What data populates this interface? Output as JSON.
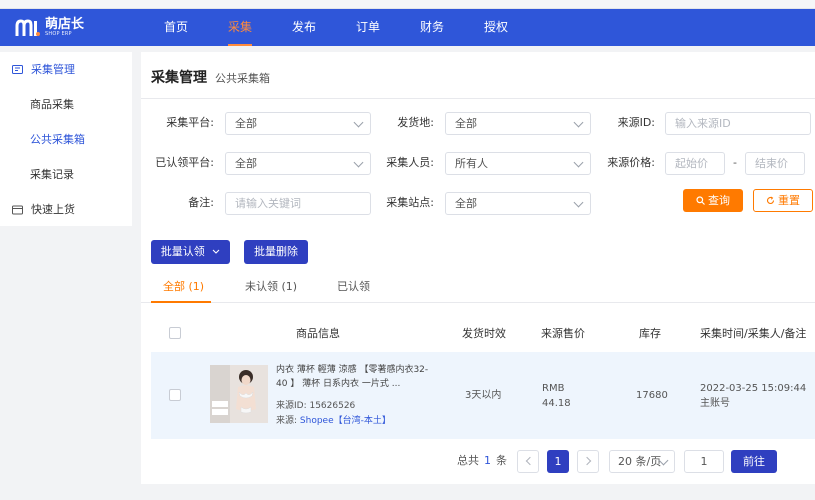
{
  "app": {
    "logo_text": "萌店长",
    "logo_sub": "SHOP ERP"
  },
  "nav": {
    "items": [
      {
        "label": "首页"
      },
      {
        "label": "采集"
      },
      {
        "label": "发布"
      },
      {
        "label": "订单"
      },
      {
        "label": "财务"
      },
      {
        "label": "授权"
      }
    ],
    "active_index": 1
  },
  "sidebar": {
    "group1": "采集管理",
    "items": [
      {
        "label": "商品采集"
      },
      {
        "label": "公共采集箱"
      },
      {
        "label": "采集记录"
      }
    ],
    "group2": "快速上货"
  },
  "page": {
    "title": "采集管理",
    "subtitle": "公共采集箱"
  },
  "filters": {
    "platform_label": "采集平台:",
    "platform_value": "全部",
    "ship_from_label": "发货地:",
    "ship_from_value": "全部",
    "source_id_label": "来源ID:",
    "source_id_placeholder": "输入来源ID",
    "claimed_platform_label": "已认领平台:",
    "claimed_platform_value": "全部",
    "collector_label": "采集人员:",
    "collector_value": "所有人",
    "price_label": "来源价格:",
    "price_min_placeholder": "起始价",
    "price_sep": "-",
    "price_max_placeholder": "结束价",
    "note_label": "备注:",
    "note_placeholder": "请输入关键词",
    "site_label": "采集站点:",
    "site_value": "全部",
    "query_label": "查询",
    "reset_label": "重置"
  },
  "actions": {
    "batch_claim": "批量认领",
    "batch_delete": "批量删除"
  },
  "tabs": [
    {
      "label": "全部 (1)"
    },
    {
      "label": "未认领 (1)"
    },
    {
      "label": "已认领"
    }
  ],
  "table": {
    "headers": {
      "product": "商品信息",
      "ship_time": "发货时效",
      "price": "来源售价",
      "stock": "库存",
      "meta": "采集时间/采集人/备注"
    },
    "rows": [
      {
        "title": "内衣 薄杯 輕薄 涼感 【零著感内衣32-40 】 薄杯 日系内衣 一片式 ...",
        "source_id": "来源ID:  15626526",
        "source_prefix": "来源:",
        "source_value": "Shopee【台湾-本土】",
        "ship_time": "3天以内",
        "currency": "RMB",
        "price": "44.18",
        "stock": "17680",
        "time": "2022-03-25 15:09:44",
        "collector": "主账号"
      }
    ]
  },
  "pagination": {
    "total_prefix": "总共",
    "total": "1",
    "total_suffix": "条",
    "current_page": "1",
    "page_size": "20 条/页",
    "goto_value": "1",
    "go_label": "前往"
  }
}
